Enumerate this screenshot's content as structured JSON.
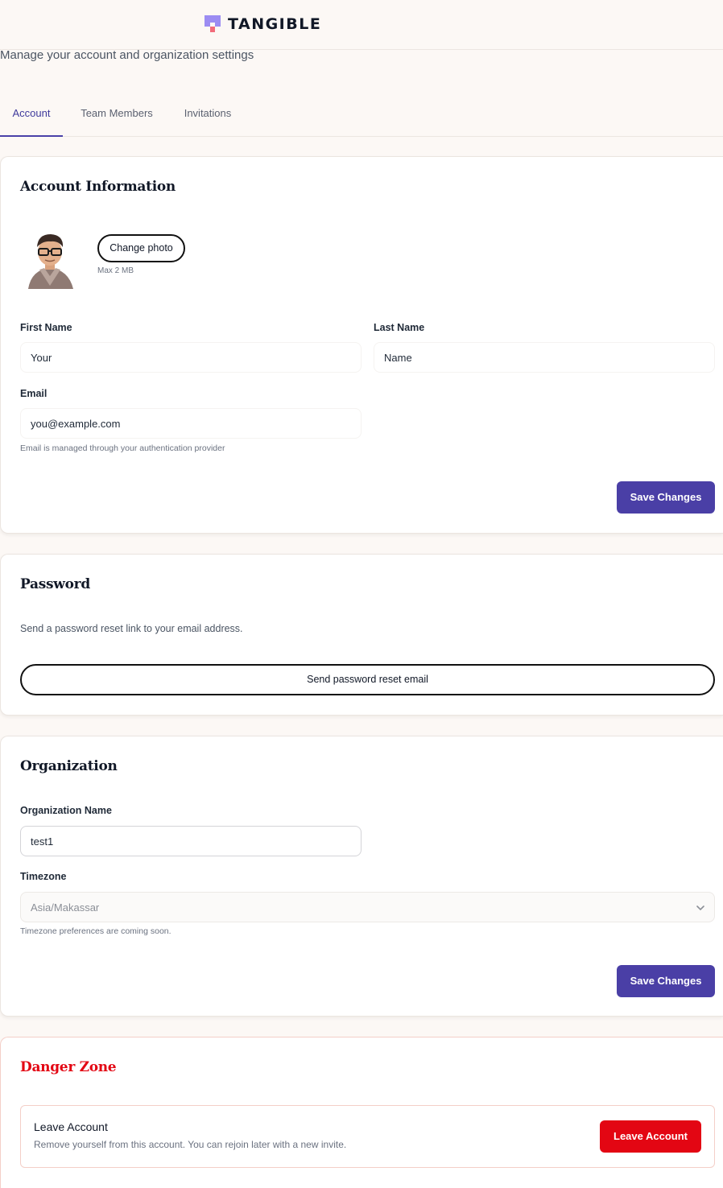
{
  "brand": {
    "name": "TANGIBLE",
    "accent": "#4a3fa6",
    "logo_purple": "#9c8cf2",
    "logo_pink": "#f26b7a"
  },
  "page": {
    "subtitle": "Manage your account and organization settings"
  },
  "tabs": [
    {
      "label": "Account",
      "active": true
    },
    {
      "label": "Team Members",
      "active": false
    },
    {
      "label": "Invitations",
      "active": false
    }
  ],
  "account": {
    "title": "Account Information",
    "change_photo_label": "Change photo",
    "photo_hint": "Max 2 MB",
    "first_name_label": "First Name",
    "first_name_value": "Your",
    "last_name_label": "Last Name",
    "last_name_value": "Name",
    "email_label": "Email",
    "email_value": "you@example.com",
    "email_help": "Email is managed through your authentication provider",
    "save_label": "Save Changes"
  },
  "password": {
    "title": "Password",
    "description": "Send a password reset link to your email address.",
    "reset_button": "Send password reset email"
  },
  "organization": {
    "title": "Organization",
    "name_label": "Organization Name",
    "name_value": "test1",
    "timezone_label": "Timezone",
    "timezone_value": "Asia/Makassar",
    "timezone_help": "Timezone preferences are coming soon.",
    "save_label": "Save Changes"
  },
  "danger": {
    "title": "Danger Zone",
    "leave_title": "Leave Account",
    "leave_description": "Remove yourself from this account. You can rejoin later with a new invite.",
    "leave_button": "Leave Account",
    "color": "#e30613"
  }
}
